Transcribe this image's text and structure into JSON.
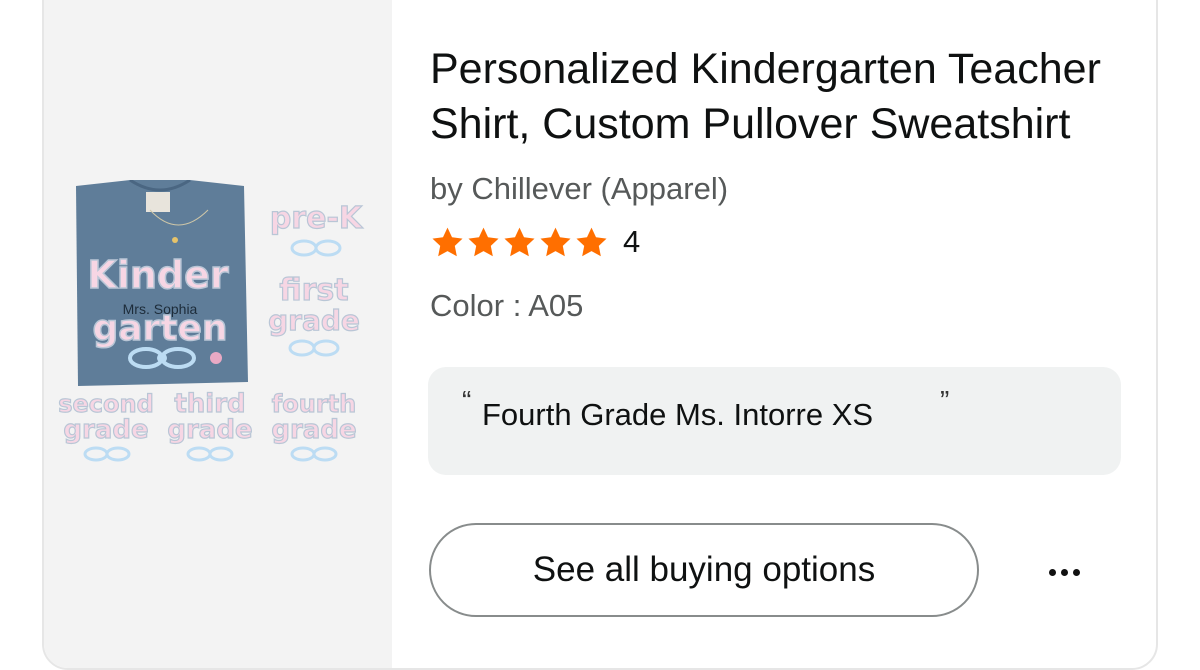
{
  "product": {
    "title": "Personalized Kindergarten Teacher Shirt, Custom Pullover Sweatshirt",
    "brand": "by Chillever (Apparel)",
    "rating_stars": 5,
    "review_count": "4",
    "color_line": "Color : A05",
    "customization": {
      "quote_open": "“",
      "text": "Fourth Grade Ms. Intorre XS",
      "quote_close": "”"
    },
    "buy_button_label": "See all buying options",
    "image_text": {
      "shirt_line1": "Kinder",
      "shirt_name": "Mrs. Sophia",
      "shirt_line2": "garten",
      "prek": "pre-K",
      "first_a": "first",
      "first_b": "grade",
      "second_a": "second",
      "second_b": "grade",
      "third_a": "third",
      "third_b": "grade",
      "fourth_a": "fourth",
      "fourth_b": "grade"
    }
  },
  "colors": {
    "star": "#ff6f00",
    "shirt": "#5f7d99",
    "letter_fill": "#f7d6e4",
    "letter_stroke": "#b9c6d6",
    "bow": "#bcdcf3"
  },
  "icons": {
    "rating": "star-icon",
    "more": "ellipsis-icon"
  }
}
